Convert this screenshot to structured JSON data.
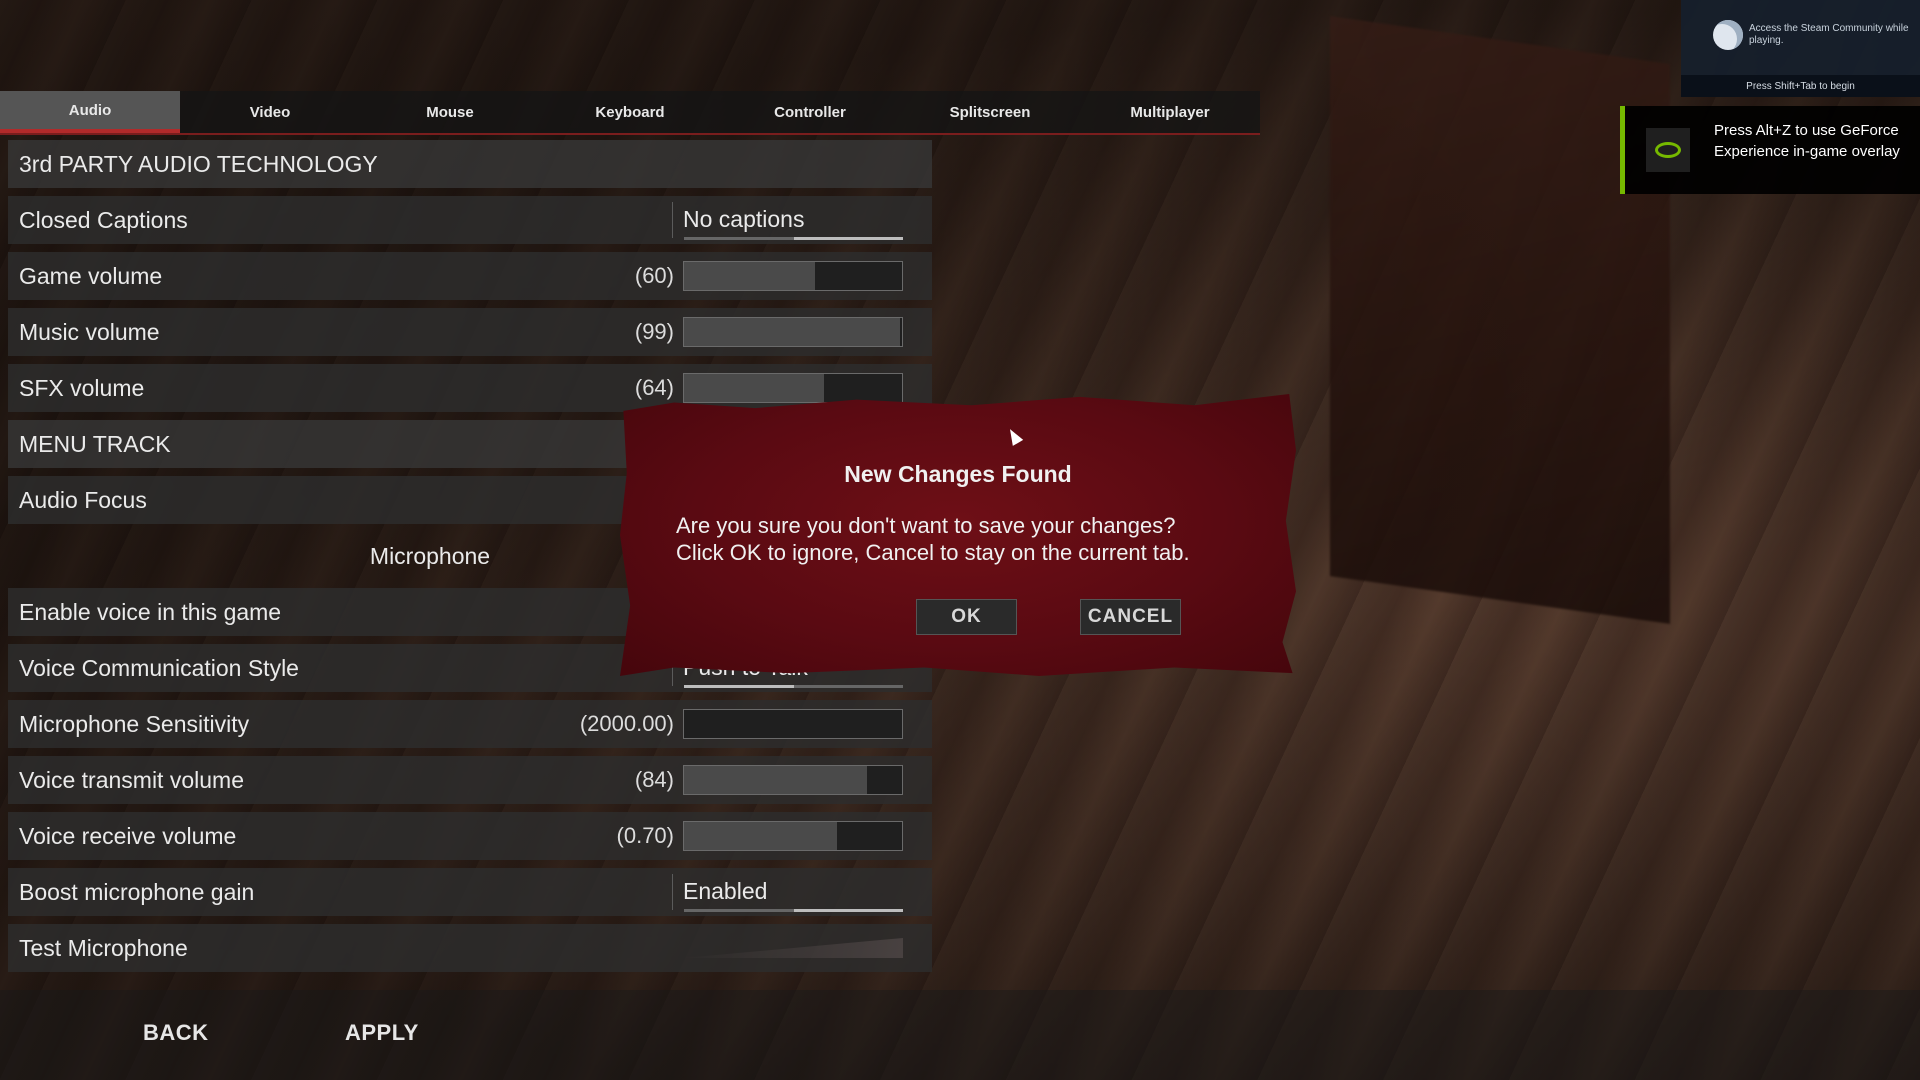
{
  "tabs": [
    "Audio",
    "Video",
    "Mouse",
    "Keyboard",
    "Controller",
    "Splitscreen",
    "Multiplayer"
  ],
  "active_tab": "Audio",
  "settings": {
    "third_party": "3rd PARTY AUDIO TECHNOLOGY",
    "closed_captions": {
      "label": "Closed Captions",
      "value": "No captions"
    },
    "game_volume": {
      "label": "Game volume",
      "value": "(60)",
      "level": 0.6
    },
    "music_volume": {
      "label": "Music volume",
      "value": "(99)",
      "level": 0.99
    },
    "sfx_volume": {
      "label": "SFX volume",
      "value": "(64)",
      "level": 0.64
    },
    "menu_track": "MENU TRACK",
    "audio_focus": "Audio Focus",
    "microphone_section": "Microphone",
    "enable_voice": "Enable voice in this game",
    "voice_comm_style": {
      "label": "Voice Communication Style",
      "value": "Push to Talk"
    },
    "mic_sensitivity": {
      "label": "Microphone Sensitivity",
      "value": "(2000.00)",
      "level": 0.0
    },
    "voice_transmit": {
      "label": "Voice transmit volume",
      "value": "(84)",
      "level": 0.84
    },
    "voice_receive": {
      "label": "Voice receive volume",
      "value": "(0.70)",
      "level": 0.7
    },
    "boost_mic": {
      "label": "Boost microphone gain",
      "value": "Enabled"
    },
    "test_mic": "Test Microphone"
  },
  "footer": {
    "back": "BACK",
    "apply": "APPLY"
  },
  "dialog": {
    "title": "New Changes Found",
    "line1": "Are you sure you don't want to save your changes?",
    "line2": "Click OK to ignore, Cancel to stay on the current tab.",
    "ok": "OK",
    "cancel": "CANCEL"
  },
  "steam_overlay": {
    "text": "Access the Steam Community while playing.",
    "hint": "Press Shift+Tab to begin"
  },
  "geforce_overlay": {
    "text": "Press Alt+Z to use GeForce Experience in-game overlay"
  },
  "colors": {
    "accent_red": "#b22a2a",
    "dialog_red": "#6e0f16",
    "nvidia_green": "#76b900"
  }
}
